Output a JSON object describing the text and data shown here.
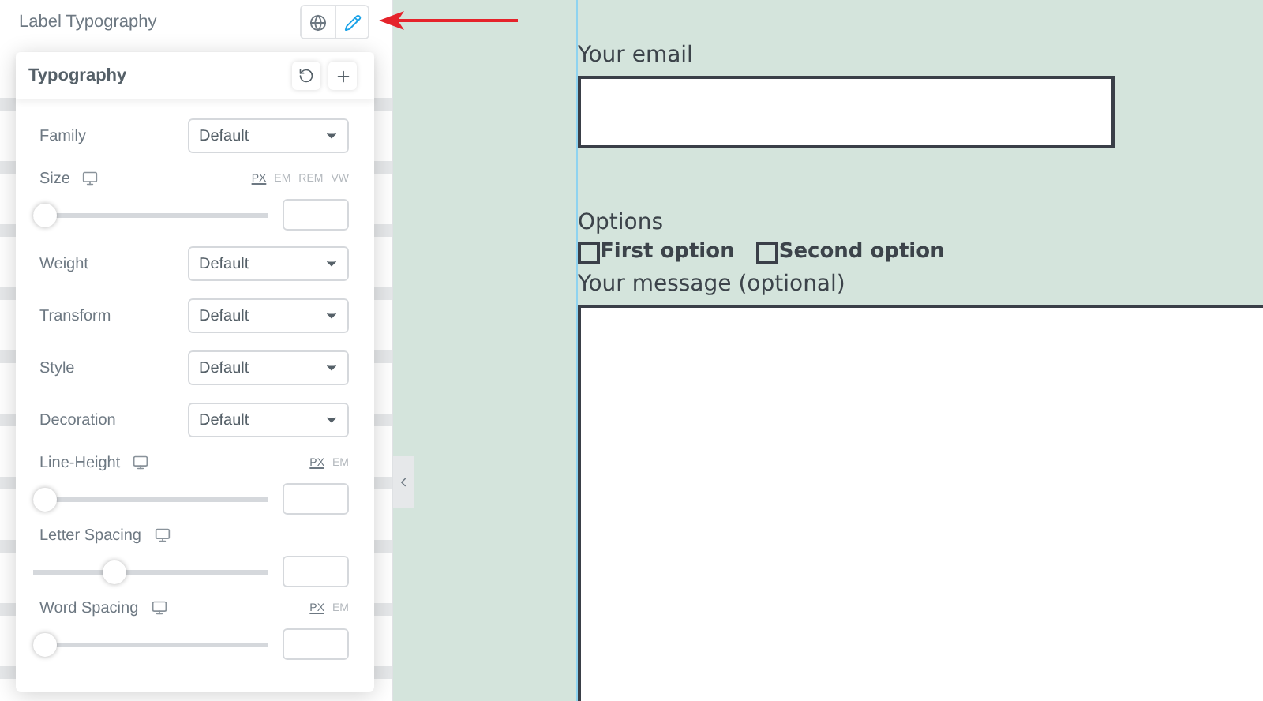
{
  "header": {
    "title": "Label Typography",
    "buttons": [
      {
        "kind": "globe",
        "selected": false
      },
      {
        "kind": "edit",
        "selected": true
      }
    ]
  },
  "popup": {
    "title": "Typography",
    "actions": [
      {
        "kind": "reset"
      },
      {
        "kind": "add"
      }
    ],
    "controls": [
      {
        "kind": "select",
        "label": "Family",
        "value": "Default"
      },
      {
        "kind": "slider",
        "label": "Size",
        "units": [
          {
            "label": "PX",
            "selected": true
          },
          {
            "label": "EM",
            "selected": false
          },
          {
            "label": "REM",
            "selected": false
          },
          {
            "label": "VW",
            "selected": false
          }
        ],
        "level": 0
      },
      {
        "kind": "select",
        "label": "Weight",
        "value": "Default"
      },
      {
        "kind": "select",
        "label": "Transform",
        "value": "Default"
      },
      {
        "kind": "select",
        "label": "Style",
        "value": "Default"
      },
      {
        "kind": "select",
        "label": "Decoration",
        "value": "Default"
      },
      {
        "kind": "slider",
        "label": "Line-Height",
        "units": [
          {
            "label": "PX",
            "selected": true
          },
          {
            "label": "EM",
            "selected": false
          }
        ],
        "level": 0
      },
      {
        "kind": "slider",
        "label": "Letter Spacing",
        "level": 0.33
      },
      {
        "kind": "slider",
        "label": "Word Spacing",
        "units": [
          {
            "label": "PX",
            "selected": true
          },
          {
            "label": "EM",
            "selected": false
          }
        ],
        "level": 0
      }
    ]
  },
  "form": {
    "fields": [
      {
        "kind": "input",
        "label": "Your email"
      },
      {
        "kind": "checkboxes",
        "label": "Options",
        "options": [
          {
            "label": "First option",
            "checked": false
          },
          {
            "label": "Second option",
            "checked": false
          }
        ]
      },
      {
        "kind": "textarea",
        "label": "Your message (optional)"
      }
    ]
  }
}
